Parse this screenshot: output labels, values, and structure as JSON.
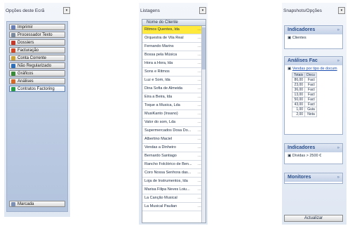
{
  "left": {
    "title": "Opções deste Ecrã",
    "buttons": [
      {
        "label": "Imprimir",
        "color": "#6a7fb3"
      },
      {
        "label": "Processador Texto",
        "color": "#7a8a9c"
      },
      {
        "label": "Dossiers",
        "color": "#c0392b"
      },
      {
        "label": "Facturação",
        "color": "#d04a2a"
      },
      {
        "label": "Conta Corrente",
        "color": "#c8a23a"
      },
      {
        "label": "Não Regularizado",
        "color": "#2e6fb8"
      },
      {
        "label": "Gráficos",
        "color": "#3a8a3a"
      },
      {
        "label": "Análises",
        "color": "#d46a2a"
      },
      {
        "label": "Contratos Factoring",
        "color": "#2a9a4a"
      }
    ],
    "footer_button": "Marcada"
  },
  "middle": {
    "title": "Listagens",
    "column_header": "Nome do Cliente",
    "rows": [
      "Ritmos Quentes, lda",
      "Orquestra de Vila Real",
      "Fernando Marins",
      "Bossa pela Música",
      "Hora a Hora, lda",
      "Sons e Ritmos",
      "Luz e Som, lda",
      "Dina Sofia de Almeida",
      "Eira a Beira, lda",
      "Toque a Musica, Lda",
      "MusiKanto (Insano)",
      "Valor do som, Lda",
      "Supermercados Dosa Do...",
      "Albertino Maciel",
      "Vendas a Dinheiro",
      "Bernardo Santiago",
      "Rancho Folclórico de Ben...",
      "Coro Nossa Senhora das...",
      "Loja de Instrumentos, lda",
      "Marisa Filipa Neves Loiu...",
      "La Canção Musical",
      "La Musical Paulian"
    ]
  },
  "right": {
    "title": "Snapshots/Opções",
    "sections": {
      "indicadores1": {
        "title": "Indicadores",
        "item": "Clientes"
      },
      "analises": {
        "title": "Análises Fac",
        "link": "Vendas por tipo de docum",
        "table_headers": [
          "Totais",
          "Docu"
        ],
        "table_rows": [
          [
            "86,00",
            "Fact"
          ],
          [
            "23,00",
            "Fact"
          ],
          [
            "36,00",
            "Fact"
          ],
          [
            "13,00",
            "Fact"
          ],
          [
            "50,00",
            "Fact"
          ],
          [
            "43,00",
            "Fact"
          ],
          [
            "1,00",
            "Guia"
          ],
          [
            "2,00",
            "Nota"
          ]
        ]
      },
      "indicadores2": {
        "title": "Indicadores",
        "item": "Dívidas > 2500 €"
      },
      "monitores": {
        "title": "Monitores"
      }
    },
    "footer_button": "Actualizar"
  }
}
